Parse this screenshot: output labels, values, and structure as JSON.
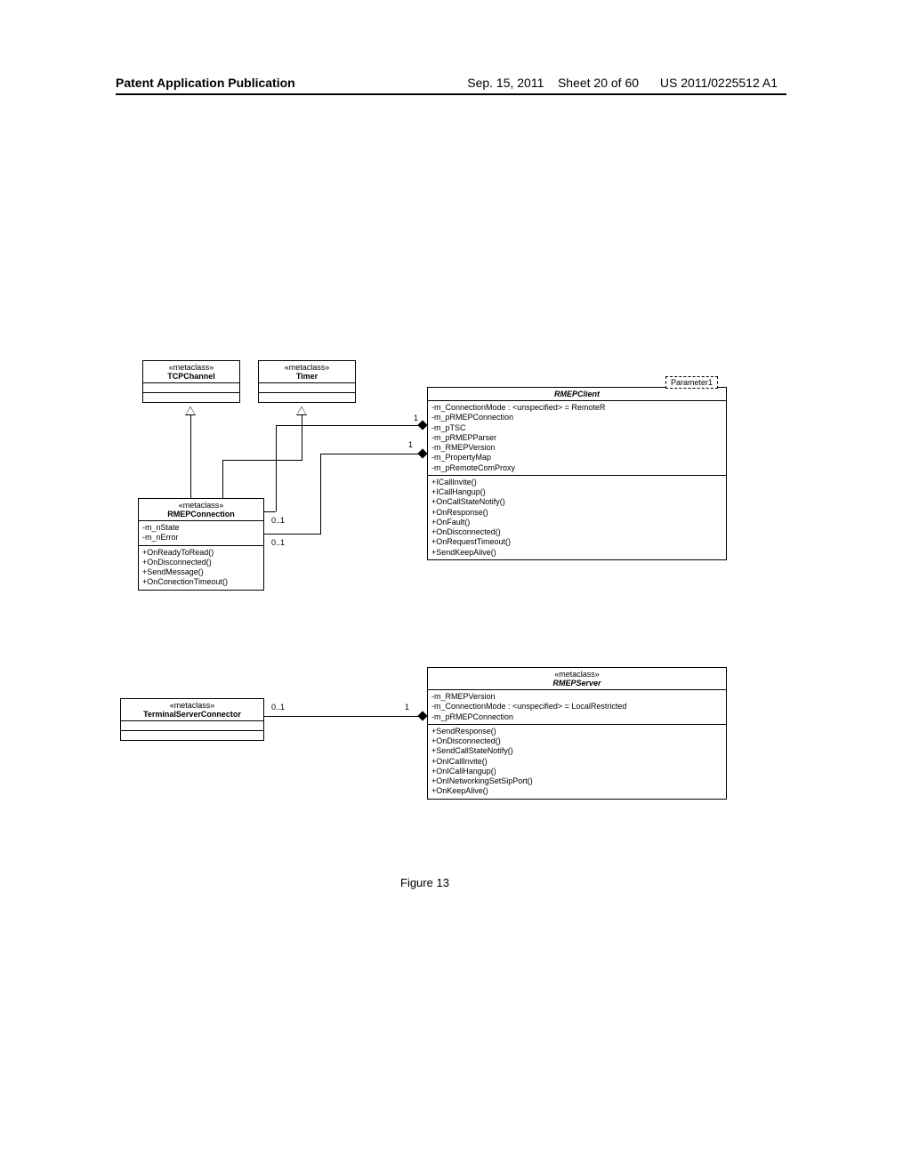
{
  "header": {
    "left": "Patent Application Publication",
    "date": "Sep. 15, 2011",
    "sheet": "Sheet 20 of 60",
    "pubno": "US 2011/0225512 A1"
  },
  "caption": "Figure 13",
  "param": "Parameter1",
  "mult": {
    "one_a": "1",
    "one_b": "1",
    "one_c": "1",
    "zo_a": "0..1",
    "zo_b": "0..1",
    "zo_c": "0..1"
  },
  "tcpchannel": {
    "stereo": "«metaclass»",
    "name": "TCPChannel"
  },
  "timer": {
    "stereo": "«metaclass»",
    "name": "Timer"
  },
  "rmepconn": {
    "stereo": "«metaclass»",
    "name": "RMEPConnection",
    "attrs": [
      "-m_nState",
      "-m_nError"
    ],
    "ops": [
      "+OnReadyToRead()",
      "+OnDisconnected()",
      "+SendMessage()",
      "+OnConectionTimeout()"
    ]
  },
  "tsc": {
    "stereo": "«metaclass»",
    "name": "TerminalServerConnector"
  },
  "client": {
    "name": "RMEPClient",
    "attrs": [
      "-m_ConnectionMode : <unspecified> = RemoteR",
      "-m_pRMEPConnection",
      "-m_pTSC",
      "-m_pRMEPParser",
      "-m_RMEPVersion",
      "-m_PropertyMap",
      "-m_pRemoteComProxy"
    ],
    "ops": [
      "+ICallInvite()",
      "+ICallHangup()",
      "+OnCallStateNotify()",
      "+OnResponse()",
      "+OnFault()",
      "+OnDisconnected()",
      "+OnRequestTimeout()",
      "+SendKeepAlive()"
    ]
  },
  "server": {
    "stereo": "«metaclass»",
    "name": "RMEPServer",
    "attrs": [
      "-m_RMEPVersion",
      "-m_ConnectionMode : <unspecified> = LocalRestricted",
      "-m_pRMEPConnection"
    ],
    "ops": [
      "+SendResponse()",
      "+OnDisconnected()",
      "+SendCallStateNotify()",
      "+OnICallInvite()",
      "+OnICallHangup()",
      "+OnINetworkingSetSipPort()",
      "+OnKeepAlive()"
    ]
  }
}
